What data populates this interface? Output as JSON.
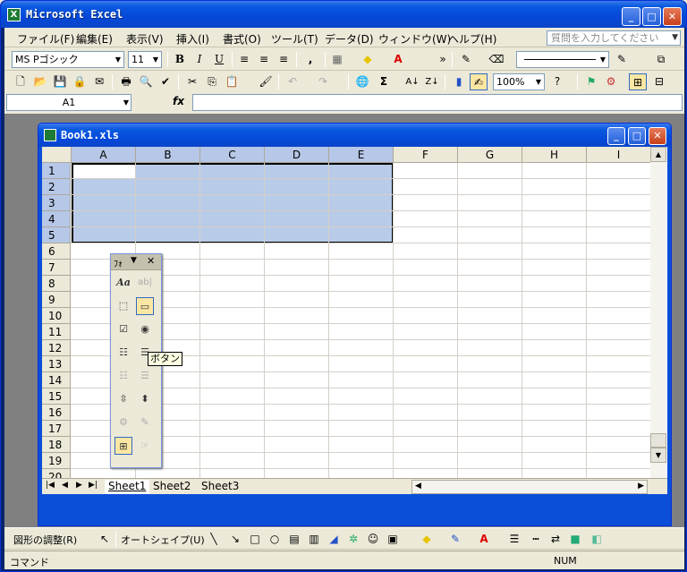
{
  "app": {
    "title": "Microsoft Excel"
  },
  "window_buttons": {
    "minimize": "_",
    "maximize": "□",
    "close": "✕"
  },
  "menu": [
    "ファイル(F)",
    "編集(E)",
    "表示(V)",
    "挿入(I)",
    "書式(O)",
    "ツール(T)",
    "データ(D)",
    "ウィンドウ(W)",
    "ヘルプ(H)"
  ],
  "help_search": {
    "placeholder": "質問を入力してください"
  },
  "format_toolbar": {
    "font": "MS Pゴシック",
    "size": "11",
    "bold": "B",
    "italic": "I",
    "underline": "U",
    "comma": ","
  },
  "standard_toolbar": {
    "zoom": "100%",
    "autosum": "Σ"
  },
  "formula_bar": {
    "name_box": "A1",
    "fx": "fx",
    "value": ""
  },
  "workbook": {
    "title": "Book1.xls"
  },
  "columns": [
    "A",
    "B",
    "C",
    "D",
    "E",
    "F",
    "G",
    "H",
    "I"
  ],
  "rows": [
    "1",
    "2",
    "3",
    "4",
    "5",
    "6",
    "7",
    "8",
    "9",
    "10",
    "11",
    "12",
    "13",
    "14",
    "15",
    "16",
    "17",
    "18",
    "19",
    "20"
  ],
  "selection": {
    "range": "A1:E5",
    "active": "A1"
  },
  "sheets": [
    "Sheet1",
    "Sheet2",
    "Sheet3"
  ],
  "active_sheet": "Sheet1",
  "forms_toolbox": {
    "title": "ﾌｫ",
    "label_tool": "Aa",
    "edit_tool": "ab|",
    "tooltip": "ボタン"
  },
  "drawing_toolbar": {
    "draw_menu": "図形の調整(R)",
    "autoshape_menu": "オートシェイプ(U)"
  },
  "status": {
    "mode": "コマンド",
    "num": "NUM"
  }
}
